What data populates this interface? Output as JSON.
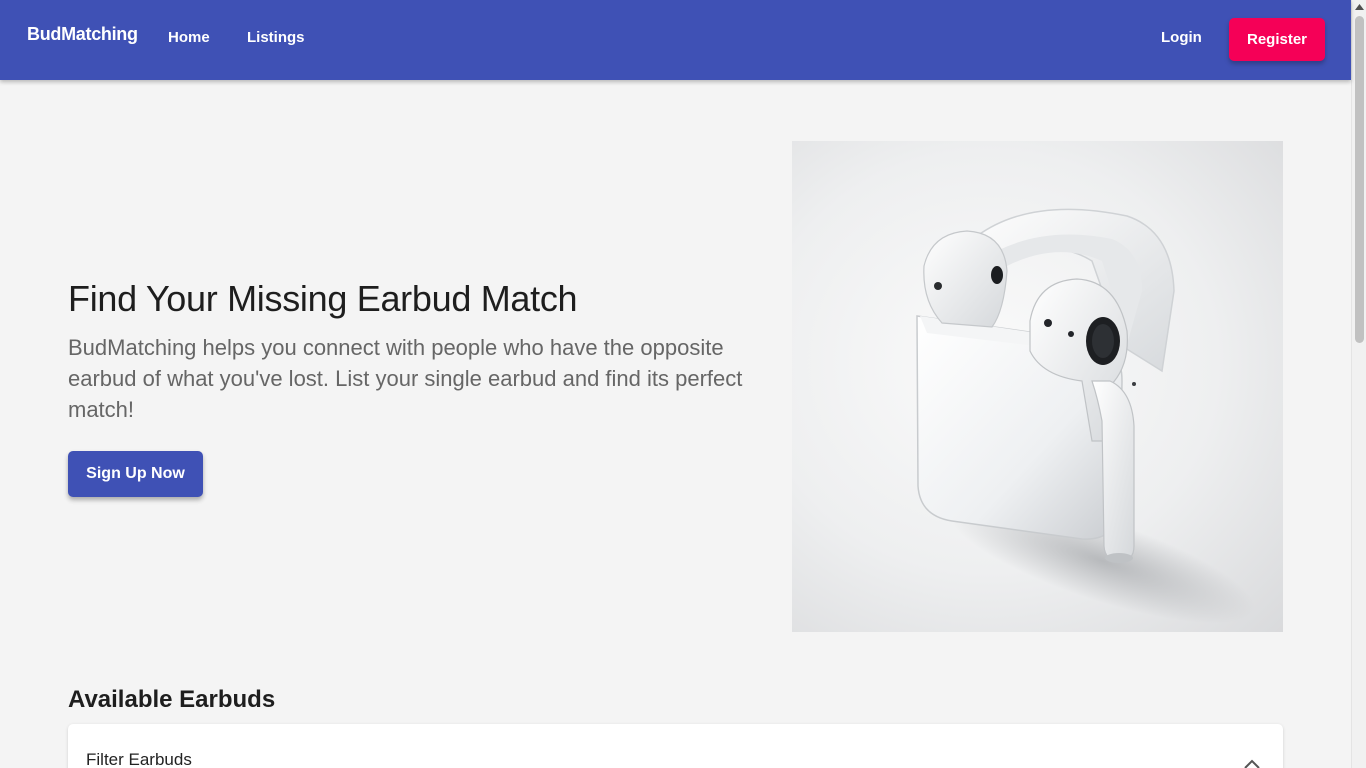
{
  "header": {
    "brand": "BudMatching",
    "nav": {
      "home": "Home",
      "listings": "Listings"
    },
    "login": "Login",
    "register": "Register"
  },
  "hero": {
    "title": "Find Your Missing Earbud Match",
    "description": "BudMatching helps you connect with people who have the opposite earbud of what you've lost. List your single earbud and find its perfect match!",
    "cta": "Sign Up Now"
  },
  "listings": {
    "title": "Available Earbuds",
    "filter_title": "Filter Earbuds"
  },
  "colors": {
    "primary": "#3f51b5",
    "accent": "#f50057",
    "background": "#f4f4f4"
  }
}
